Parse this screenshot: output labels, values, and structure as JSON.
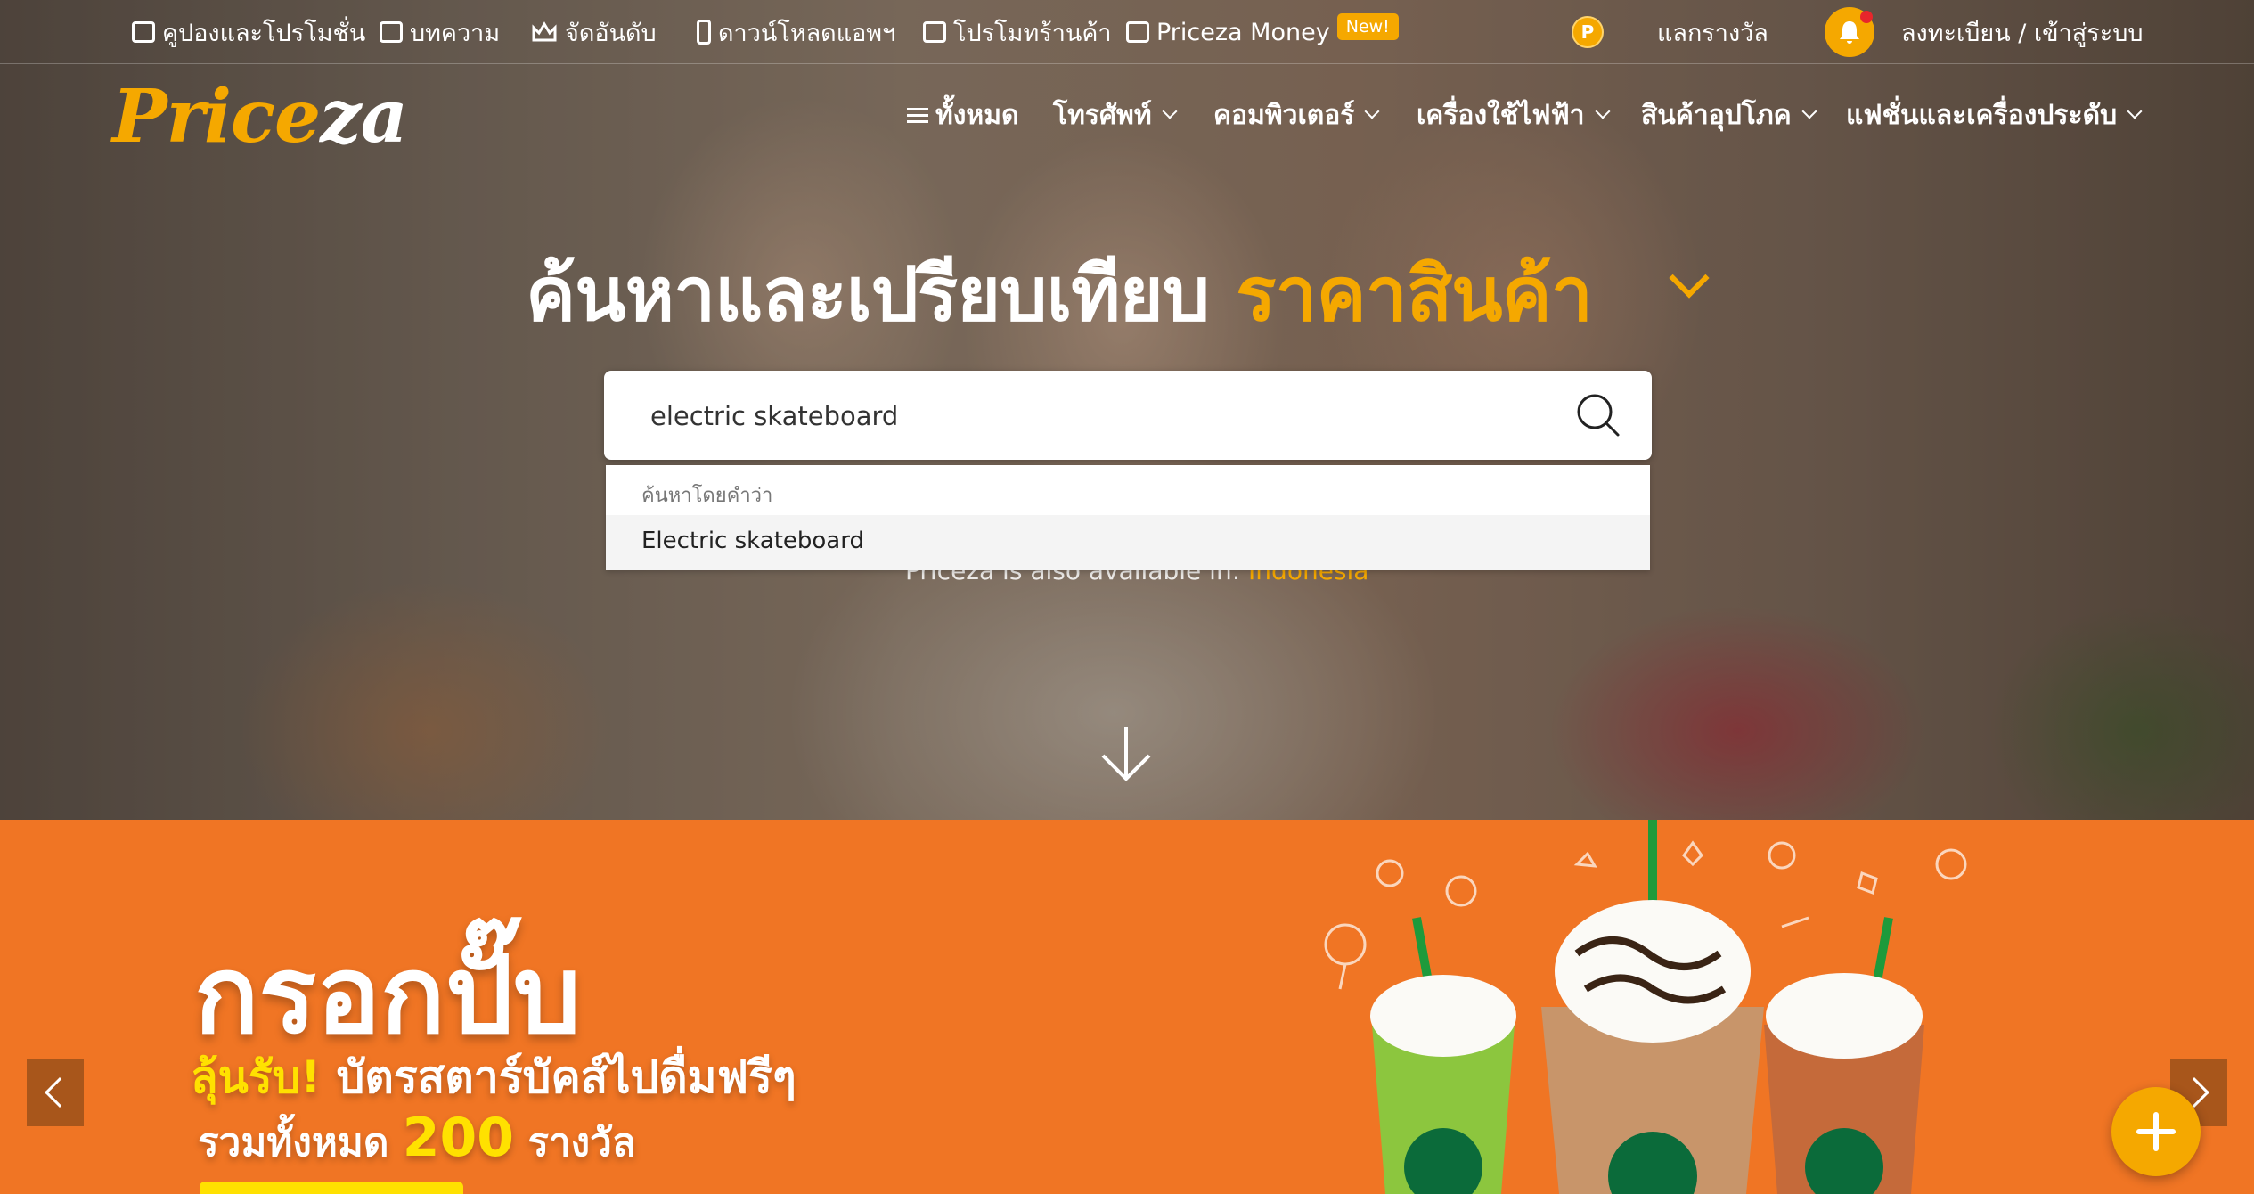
{
  "topbar": {
    "coupons": "คูปองและโปรโมชั่น",
    "articles": "บทความ",
    "ranking": "จัดอันดับ",
    "download_app": "ดาวน์โหลดแอพฯ",
    "shop_promo": "โปรโมทร้านค้า",
    "money": "Priceza Money",
    "new_badge": "New!",
    "coin_letter": "P",
    "rewards": "แลกรางวัล",
    "login": "ลงทะเบียน / เข้าสู่ระบบ"
  },
  "logo": {
    "part1": "Price",
    "part2": "za"
  },
  "nav": {
    "all": "ทั้งหมด",
    "phone": "โทรศัพท์",
    "computer": "คอมพิวเตอร์",
    "appliances": "เครื่องใช้ไฟฟ้า",
    "consumer": "สินค้าอุปโภค",
    "fashion": "แฟชั่นและเครื่องประดับ"
  },
  "hero": {
    "headline": "ค้นหาและเปรียบเทียบ",
    "headline_highlight": "ราคาสินค้า"
  },
  "search": {
    "value": "electric skateboard",
    "suggest_header": "ค้นหาโดยคำว่า",
    "suggestion": "Electric skateboard"
  },
  "also_available": {
    "text": "Priceza is also available in:",
    "link": "Indonesia"
  },
  "banner": {
    "title": "กรอกปั๊บ",
    "line2_highlight": "ลุ้นรับ!",
    "line2_rest": "บัตรสตาร์บัคส์ไปดื่มฟรีๆ",
    "line3_pre": "รวมทั้งหมด",
    "line3_num": "200",
    "line3_post": "รางวัล"
  },
  "colors": {
    "brand": "#f5a800",
    "banner": "#f07524",
    "highlight": "#ffe100"
  },
  "icons": [
    "coupon-icon",
    "article-icon",
    "crown-icon",
    "phone-icon",
    "shop-icon",
    "wallet-icon",
    "bell-icon",
    "menu-icon",
    "search-icon",
    "arrow-down-icon",
    "chevron-left-icon",
    "chevron-right-icon",
    "plus-icon"
  ]
}
